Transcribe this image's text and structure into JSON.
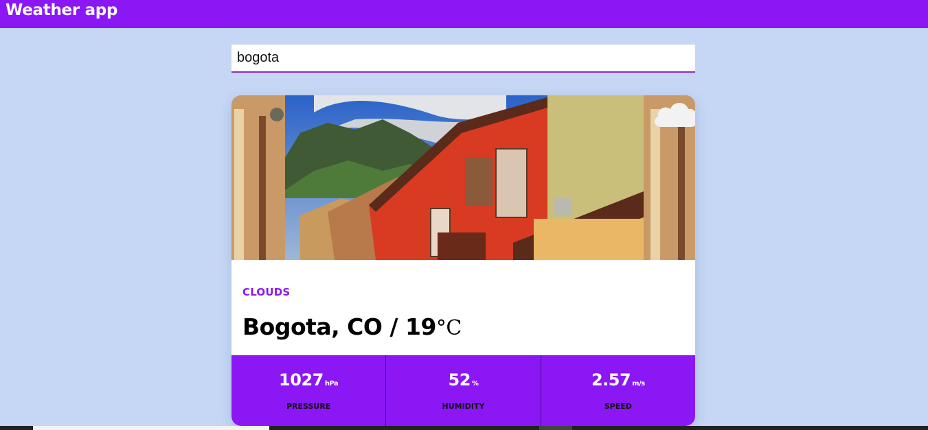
{
  "app": {
    "title": "Weather app"
  },
  "search": {
    "value": "bogota"
  },
  "weather": {
    "condition": "CLOUDS",
    "location": "Bogota, CO / 19",
    "temp_unit": "°C",
    "stats": [
      {
        "value": "1027",
        "unit": "hPa",
        "label": "PRESSURE"
      },
      {
        "value": "52",
        "unit": "%",
        "label": "HUMIDITY"
      },
      {
        "value": "2.57",
        "unit": "m/s",
        "label": "SPEED"
      }
    ]
  },
  "icons": {
    "weather": "cloud-icon"
  },
  "colors": {
    "accent": "#8b17f5",
    "background": "#c5d7f5"
  }
}
